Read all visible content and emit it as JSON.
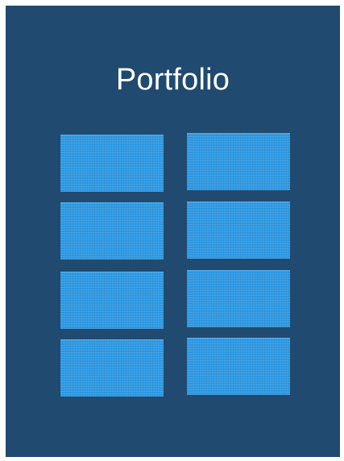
{
  "page": {
    "title": "Portfolio",
    "background_color": "#204a6f",
    "tile_color": "#2f9ae4"
  },
  "tiles": [
    {
      "row": 1,
      "column": 1
    },
    {
      "row": 1,
      "column": 2
    },
    {
      "row": 2,
      "column": 1
    },
    {
      "row": 2,
      "column": 2
    },
    {
      "row": 3,
      "column": 1
    },
    {
      "row": 3,
      "column": 2
    },
    {
      "row": 4,
      "column": 1
    },
    {
      "row": 4,
      "column": 2
    }
  ]
}
